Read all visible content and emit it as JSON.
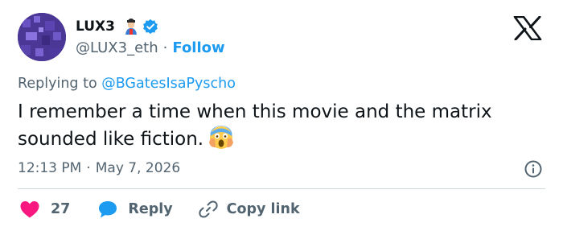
{
  "account": {
    "name": "LUX3",
    "handle": "@LUX3_eth",
    "separator": "·",
    "follow_label": "Follow"
  },
  "tweet": {
    "reply_prefix": "Replying to ",
    "reply_to": "@BGatesIsaPyscho",
    "text": "I remember a time when this movie and the matrix sounded like fiction.",
    "time": "12:13 PM",
    "date_separator": "·",
    "date": "May 7, 2026"
  },
  "actions": {
    "like_count": "27",
    "reply_label": "Reply",
    "copy_link_label": "Copy link"
  },
  "icons": {
    "verified": "verified-badge-icon",
    "x_logo": "x-logo-icon",
    "info": "info-icon",
    "like": "heart-icon",
    "reply": "speech-bubble-icon",
    "copy": "link-icon",
    "scream_emoji": "screaming-face-emoji",
    "name_emoji": "person-emoji"
  },
  "colors": {
    "accent": "#1d9bf0",
    "like": "#f91880",
    "text": "#0f1419",
    "secondary": "#536471"
  }
}
